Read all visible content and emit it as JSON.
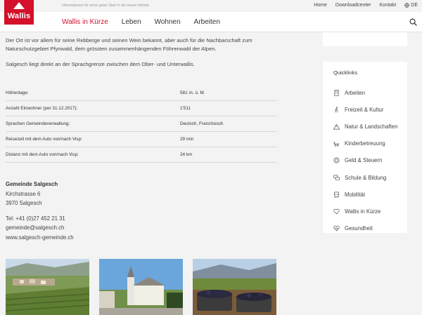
{
  "topbar": {
    "tagline": "Informationen für einen guten Start in der neuen Heimat",
    "links": [
      "Home",
      "Downloadcenter",
      "Kontakt"
    ],
    "language": "DE"
  },
  "logo": {
    "text": "Wallis"
  },
  "nav": {
    "items": [
      "Wallis in Kürze",
      "Leben",
      "Wohnen",
      "Arbeiten"
    ],
    "active_index": 0
  },
  "main": {
    "paragraph1": "Der Ort ist vor allem für seine Rebberge und seinen Wein bekannt, aber auch für die Nachbarschaft zum Naturschutzgebiet Pfynwald, dem grössten zusammenhängenden Föhrenwald der Alpen.",
    "paragraph2": "Salgesch liegt direkt an der Sprachgrenze zwischen dem Ober- und Unterwallis.",
    "facts": [
      {
        "label": "Höhenlage:",
        "value": "581 m. ü. M."
      },
      {
        "label": "Anzahl Einwohner (per 31.12.2017):",
        "value": "1'511"
      },
      {
        "label": "Sprachen Gemeindeverwaltung:",
        "value": "Deutsch, Französisch"
      },
      {
        "label": "Reisezeit mit dem Auto von/nach Visp:",
        "value": "29 min"
      },
      {
        "label": "Distanz mit dem Auto von/nach Visp:",
        "value": "24 km"
      }
    ],
    "contact": {
      "org": "Gemeinde Salgesch",
      "street": "Kirchstrasse 6",
      "city": "3970 Salgesch",
      "phone": "Tel: +41 (0)27 452 21 31",
      "email": "gemeinde@salgesch.ch",
      "website": "www.salgesch-gemeinde.ch"
    }
  },
  "sidebar": {
    "title": "Quicklinks",
    "items": [
      {
        "label": "Arbeiten",
        "icon": "office-building-icon"
      },
      {
        "label": "Freizeit & Kultur",
        "icon": "hiker-icon"
      },
      {
        "label": "Natur & Landschaften",
        "icon": "mountain-icon"
      },
      {
        "label": "Kinderbetreuung",
        "icon": "stroller-icon"
      },
      {
        "label": "Geld & Steuern",
        "icon": "coins-icon"
      },
      {
        "label": "Schule & Bildung",
        "icon": "chat-bubbles-icon"
      },
      {
        "label": "Mobilität",
        "icon": "bus-icon"
      },
      {
        "label": "Wallis in Kürze",
        "icon": "heart-icon"
      },
      {
        "label": "Gesundheit",
        "icon": "heartbeat-icon"
      }
    ]
  },
  "colors": {
    "brand_red": "#d4102a",
    "background": "#f3f3f3"
  }
}
